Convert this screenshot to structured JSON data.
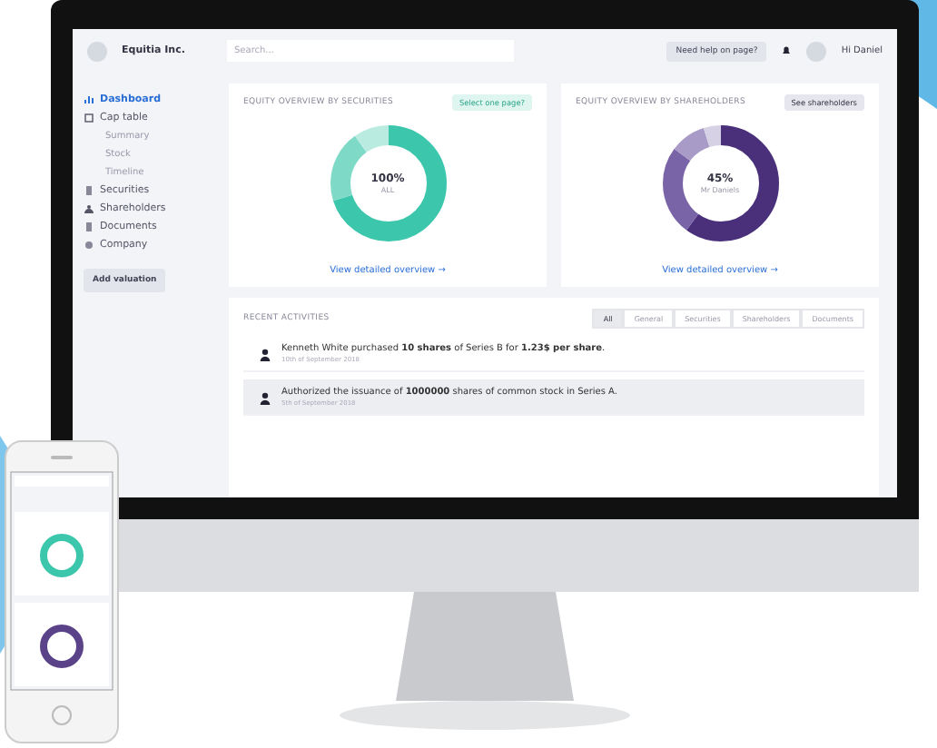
{
  "topbar": {
    "company": "Equitia Inc.",
    "search": {
      "placeholder": "Search..."
    },
    "help_button": "Need help on page?",
    "user": "Hi Daniel"
  },
  "sidebar": {
    "items": [
      {
        "label": "Dashboard",
        "selected": true
      },
      {
        "label": "Cap table",
        "selected": false,
        "children": [
          {
            "label": "Summary",
            "selected": false
          },
          {
            "label": "Stock",
            "selected": false
          },
          {
            "label": "Timeline",
            "selected": false
          }
        ]
      },
      {
        "label": "Securities",
        "selected": false
      },
      {
        "label": "Shareholders",
        "selected": false
      },
      {
        "label": "Documents",
        "selected": false
      },
      {
        "label": "Company",
        "selected": false
      }
    ],
    "button": "Add valuation"
  },
  "cards": [
    {
      "title": "EQUITY OVERVIEW BY SECURITIES",
      "button": "Select one page?",
      "center_value": "100%",
      "center_label": "ALL",
      "link": "View detailed overview →"
    },
    {
      "title": "EQUITY OVERVIEW BY SHAREHOLDERS",
      "button": "See shareholders",
      "center_value": "45%",
      "center_label": "Mr Daniels",
      "link": "View detailed overview →"
    }
  ],
  "activities": {
    "title": "RECENT ACTIVITIES",
    "tabs": [
      {
        "label": "All",
        "selected": true
      },
      {
        "label": "General",
        "selected": false
      },
      {
        "label": "Securities",
        "selected": false
      },
      {
        "label": "Shareholders",
        "selected": false
      },
      {
        "label": "Documents",
        "selected": false
      }
    ],
    "items": [
      {
        "text": "Kenneth White purchased **10 shares** of Series B for **1.23$ per share**.",
        "date": "10th of September 2018",
        "highlighted": false
      },
      {
        "text": "Authorized the issuance of **1000000** shares of common stock in Series A.",
        "date": "5th of September 2018",
        "highlighted": true
      }
    ]
  }
}
